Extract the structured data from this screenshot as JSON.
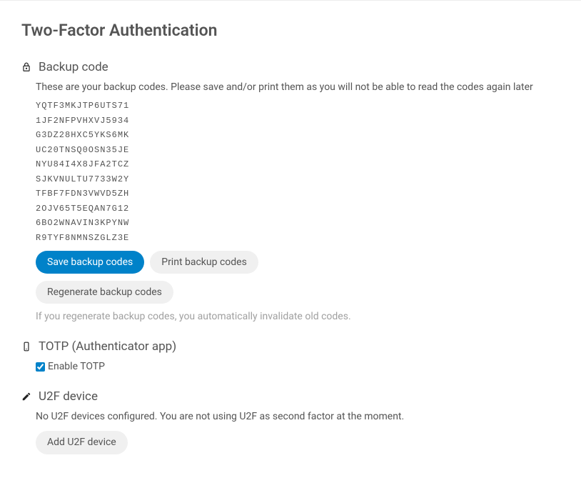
{
  "page_title": "Two-Factor Authentication",
  "backup": {
    "heading": "Backup code",
    "description": "These are your backup codes. Please save and/or print them as you will not be able to read the codes again later",
    "codes": [
      "YQTF3MKJTP6UTS71",
      "1JF2NFPVHXVJ5934",
      "G3DZ28HXC5YKS6MK",
      "UC20TNSQ0OSN35JE",
      "NYU84I4X8JFA2TCZ",
      "SJKVNULTU7733W2Y",
      "TFBF7FDN3VWVD5ZH",
      "2OJV65T5EQAN7G12",
      "6BO2WNAVIN3KPYNW",
      "R9TYF8NMNSZGLZ3E"
    ],
    "save_label": "Save backup codes",
    "print_label": "Print backup codes",
    "regenerate_label": "Regenerate backup codes",
    "regenerate_hint": "If you regenerate backup codes, you automatically invalidate old codes."
  },
  "totp": {
    "heading": "TOTP (Authenticator app)",
    "enable_label": "Enable TOTP",
    "enabled": true
  },
  "u2f": {
    "heading": "U2F device",
    "none_text": "No U2F devices configured. You are not using U2F as second factor at the moment.",
    "add_label": "Add U2F device"
  }
}
